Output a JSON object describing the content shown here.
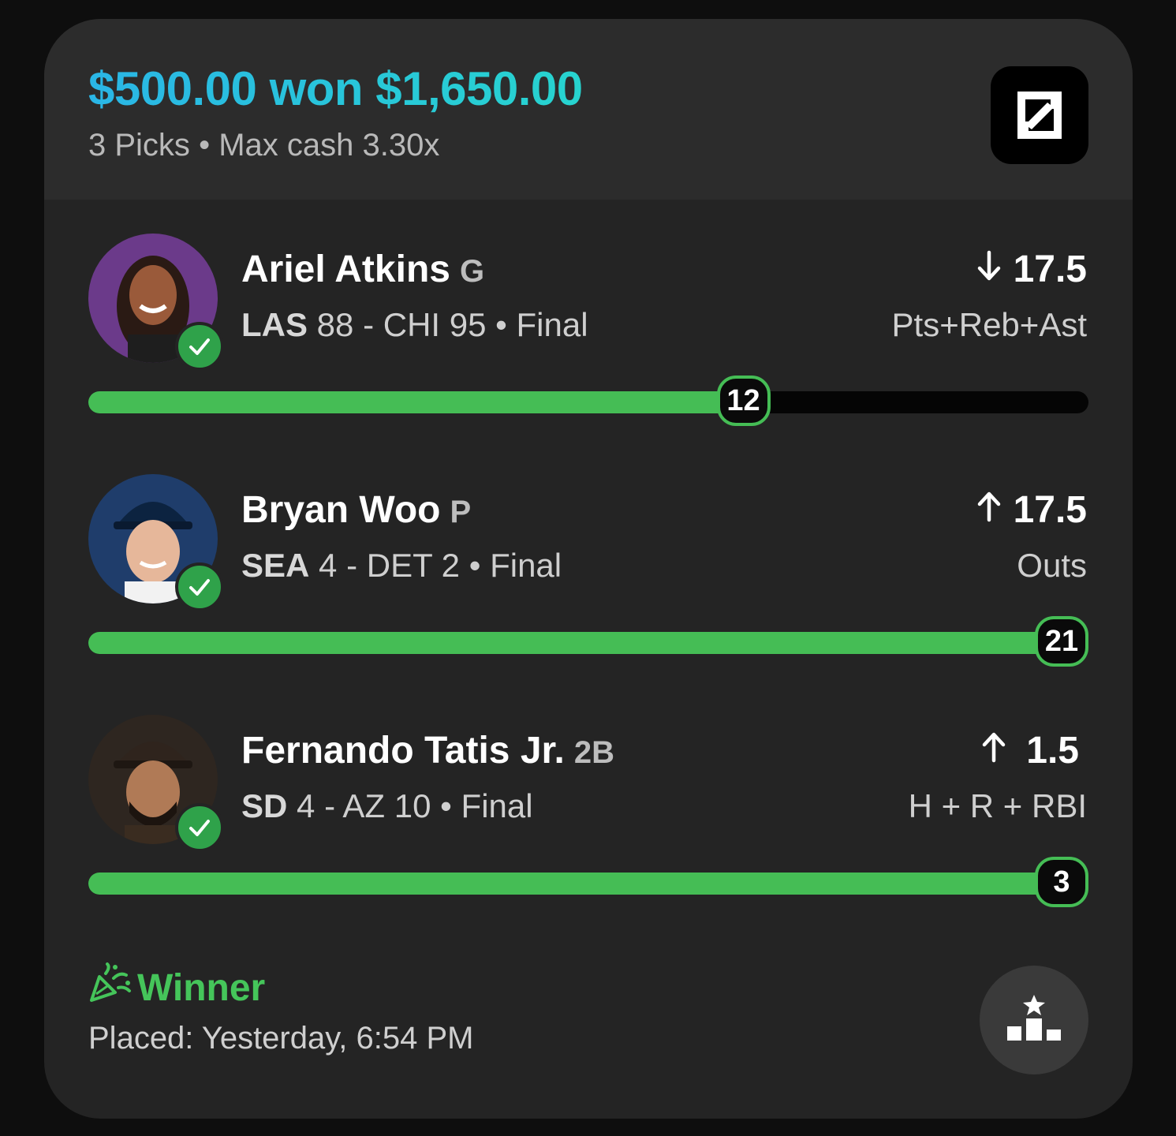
{
  "header": {
    "stake": "$500.00",
    "won_word": "won",
    "payout": "$1,650.00",
    "picks_count": "3 Picks",
    "separator": "•",
    "max_cash": "Max cash 3.30x",
    "logo_icon": "app-logo-icon"
  },
  "colors": {
    "accent_gradient_start": "#2ab6e6",
    "accent_gradient_end": "#27d4cf",
    "progress_green": "#45bd55",
    "card_bg": "#242424"
  },
  "picks": [
    {
      "player": "Ariel Atkins",
      "position": "G",
      "team_a": "LAS",
      "score_a": "88",
      "dash": "-",
      "team_b": "CHI",
      "score_b": "95",
      "status": "Final",
      "direction_icon": "arrow-down-icon",
      "line": "17.5",
      "stat": "Pts+Reb+Ast",
      "actual": "12",
      "progress": 0.655,
      "result_icon": "check-icon"
    },
    {
      "player": "Bryan Woo",
      "position": "P",
      "team_a": "SEA",
      "score_a": "4",
      "dash": "-",
      "team_b": "DET",
      "score_b": "2",
      "status": "Final",
      "direction_icon": "arrow-up-icon",
      "line": "17.5",
      "stat": "Outs",
      "actual": "21",
      "progress": 1.0,
      "result_icon": "check-icon"
    },
    {
      "player": "Fernando Tatis Jr.",
      "position": "2B",
      "team_a": "SD",
      "score_a": "4",
      "dash": "-",
      "team_b": "AZ",
      "score_b": "10",
      "status": "Final",
      "direction_icon": "arrow-up-icon",
      "line": "1.5",
      "stat": "H + R + RBI",
      "actual": "3",
      "progress": 1.0,
      "result_icon": "check-icon"
    }
  ],
  "footer": {
    "result_label": "Winner",
    "result_icon": "confetti-icon",
    "placed": "Placed: Yesterday, 6:54 PM",
    "leaderboard_icon": "podium-star-icon"
  }
}
